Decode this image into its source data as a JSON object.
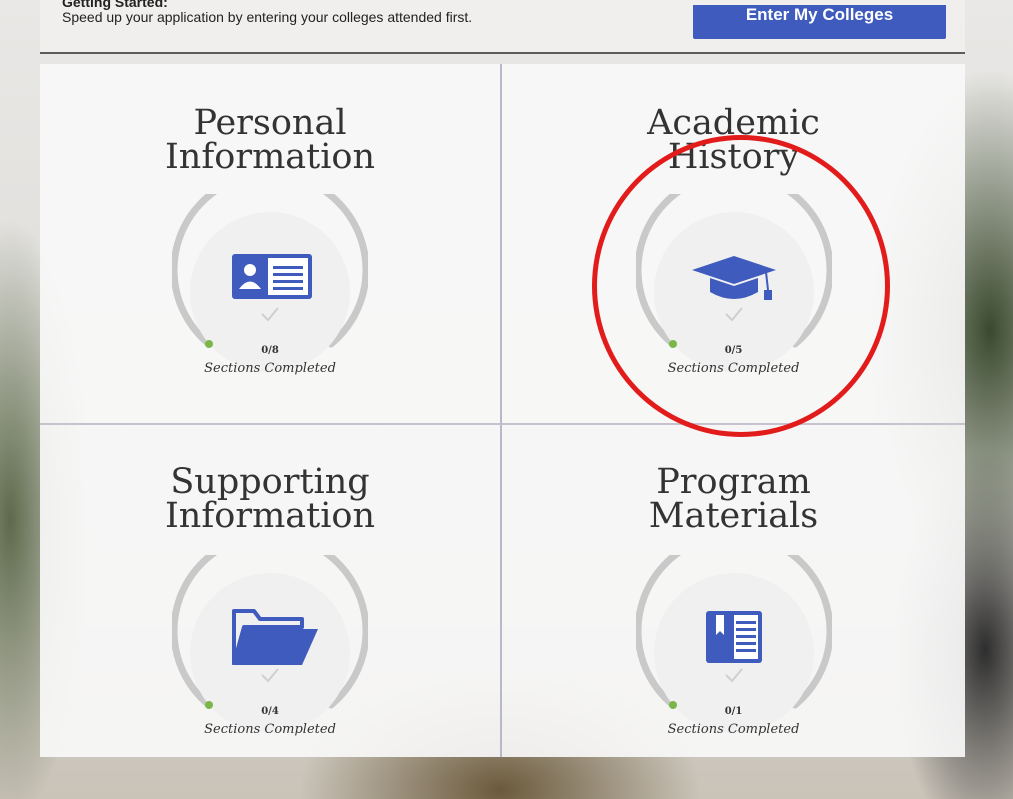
{
  "header": {
    "heading": "Getting Started:",
    "subtext": "Speed up your application by entering your colleges attended first.",
    "button_label": "Enter My Colleges"
  },
  "tiles": [
    {
      "title_line1": "Personal",
      "title_line2": "Information",
      "count": "0/8",
      "status": "Sections Completed",
      "icon": "id-card-icon",
      "progress": 0
    },
    {
      "title_line1": "Academic",
      "title_line2": "History",
      "count": "0/5",
      "status": "Sections Completed",
      "icon": "graduation-cap-icon",
      "progress": 0
    },
    {
      "title_line1": "Supporting",
      "title_line2": "Information",
      "count": "0/4",
      "status": "Sections Completed",
      "icon": "folder-icon",
      "progress": 0
    },
    {
      "title_line1": "Program",
      "title_line2": "Materials",
      "count": "0/1",
      "status": "Sections Completed",
      "icon": "book-icon",
      "progress": 0
    }
  ],
  "colors": {
    "accent": "#3e5bbd",
    "icon": "#3e5bbd",
    "ring": "#c9c9c9",
    "progress_dot": "#7ab648",
    "annotation": "#e21b1b"
  }
}
